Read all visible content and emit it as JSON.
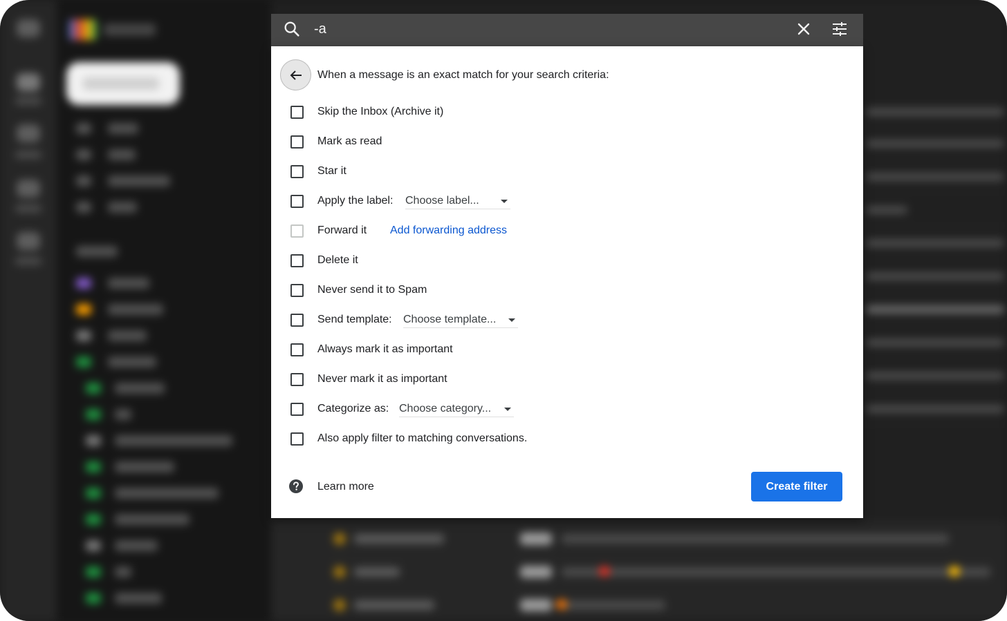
{
  "search": {
    "query": "-a"
  },
  "filter_panel": {
    "header": "When a message is an exact match for your search criteria:",
    "options": [
      {
        "label": "Skip the Inbox (Archive it)",
        "checked": false
      },
      {
        "label": "Mark as read",
        "checked": false
      },
      {
        "label": "Star it",
        "checked": false
      },
      {
        "label": "Apply the label:",
        "checked": false,
        "dropdown": "Choose label..."
      },
      {
        "label": "Forward it",
        "checked": false,
        "disabled": true,
        "link": "Add forwarding address"
      },
      {
        "label": "Delete it",
        "checked": false
      },
      {
        "label": "Never send it to Spam",
        "checked": false
      },
      {
        "label": "Send template:",
        "checked": false,
        "dropdown": "Choose template..."
      },
      {
        "label": "Always mark it as important",
        "checked": false
      },
      {
        "label": "Never mark it as important",
        "checked": false
      },
      {
        "label": "Categorize as:",
        "checked": false,
        "dropdown": "Choose category..."
      },
      {
        "label": "Also apply filter to matching conversations.",
        "checked": false
      }
    ],
    "learn_more": "Learn more",
    "create_button": "Create filter"
  },
  "icons": {
    "search": "search-icon",
    "clear": "close-icon",
    "options": "tune-icon",
    "back": "arrow-back-icon",
    "help": "help-icon"
  },
  "colors": {
    "primary_button": "#1a73e8",
    "link": "#0b57d0",
    "search_bar": "#474747"
  }
}
